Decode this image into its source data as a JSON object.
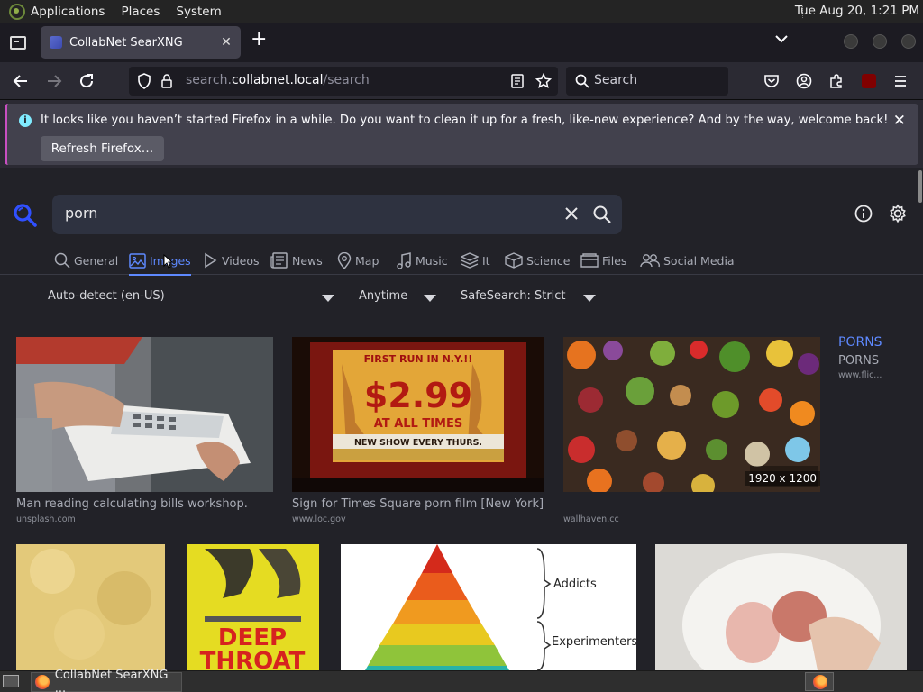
{
  "top_panel": {
    "menus": [
      "Applications",
      "Places",
      "System"
    ],
    "clock": "Tue Aug 20,  1:21 PM"
  },
  "browser": {
    "tab_title": "CollabNet SearXNG",
    "tab_close": "✕",
    "new_tab": "+",
    "url_host_prefix": "search.",
    "url_host": "collabnet.local",
    "url_path": "/search",
    "search_placeholder": "Search"
  },
  "notification": {
    "message": "It looks like you haven’t started Firefox in a while. Do you want to clean it up for a fresh, like-new experience? And by the way, welcome back!",
    "button_label": "Refresh Firefox…",
    "close": "✕"
  },
  "search": {
    "query": "porn",
    "categories": [
      {
        "label": "General",
        "icon": "search-icon"
      },
      {
        "label": "Images",
        "icon": "image-icon",
        "active": true
      },
      {
        "label": "Videos",
        "icon": "play-icon"
      },
      {
        "label": "News",
        "icon": "newspaper-icon"
      },
      {
        "label": "Map",
        "icon": "map-pin-icon"
      },
      {
        "label": "Music",
        "icon": "music-note-icon"
      },
      {
        "label": "It",
        "icon": "layers-icon"
      },
      {
        "label": "Science",
        "icon": "cube-icon"
      },
      {
        "label": "Files",
        "icon": "folder-icon"
      },
      {
        "label": "Social Media",
        "icon": "people-icon"
      }
    ],
    "filters": {
      "language": "Auto-detect (en-US)",
      "time": "Anytime",
      "safesearch": "SafeSearch: Strict"
    }
  },
  "results": [
    {
      "title": "Man reading calculating bills workshop.",
      "source": "unsplash.com"
    },
    {
      "title": "Sign for Times Square porn film [New York]",
      "source": "www.loc.gov"
    },
    {
      "title": "",
      "source": "wallhaven.cc",
      "dimensions": "1920 x 1200"
    }
  ],
  "side_result": {
    "title": "PORNS",
    "subtitle": "PORNS",
    "source": "www.flic..."
  },
  "image_text": {
    "poster_first_run": "FIRST RUN IN N.Y.!!",
    "poster_price": "$2.99",
    "poster_at_all_times": "AT ALL TIMES",
    "poster_new_show": "NEW SHOW EVERY THURS.",
    "deep_throat_line1": "DEEP",
    "deep_throat_line2": "THROAT",
    "pyramid_label_1": "Addicts",
    "pyramid_label_2": "Experimenters"
  },
  "taskbar": {
    "window_title": "CollabNet SearXNG ..."
  },
  "colors": {
    "accent": "#5e89ff",
    "page_bg": "#222228",
    "notice_stripe": "#c84fc1"
  }
}
